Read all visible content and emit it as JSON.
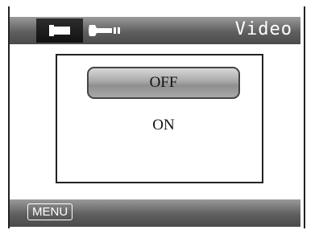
{
  "topbar": {
    "title": "Video",
    "tabs": [
      {
        "icon": "video-camera-icon",
        "selected": true
      },
      {
        "icon": "wrench-settings-icon",
        "selected": false
      }
    ]
  },
  "dialog": {
    "options": [
      {
        "label": "OFF",
        "selected": true
      },
      {
        "label": "ON",
        "selected": false
      }
    ]
  },
  "bottombar": {
    "menu_label": "MENU"
  }
}
